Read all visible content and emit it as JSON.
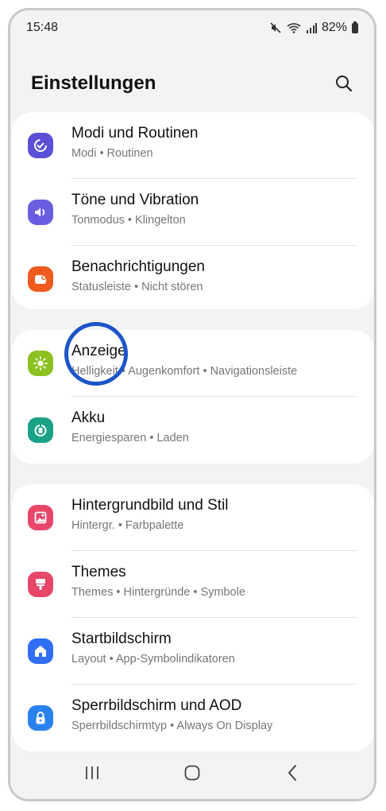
{
  "status_bar": {
    "time": "15:48",
    "battery": "82%"
  },
  "header": {
    "title": "Einstellungen"
  },
  "groups": [
    {
      "items": [
        {
          "title": "Modi und Routinen",
          "subtitle": "Modi  •  Routinen",
          "icon": "modes-icon",
          "color": "#5b4fd8"
        },
        {
          "title": "Töne und Vibration",
          "subtitle": "Tonmodus  •  Klingelton",
          "icon": "sound-icon",
          "color": "#6a5ee0"
        },
        {
          "title": "Benachrichtigungen",
          "subtitle": "Statusleiste  •  Nicht stören",
          "icon": "notification-icon",
          "color": "#ef5a1e"
        }
      ]
    },
    {
      "items": [
        {
          "title": "Anzeige",
          "subtitle": "Helligkeit  •  Augenkomfort  •  Navigationsleiste",
          "icon": "display-icon",
          "color": "#8cc11f"
        },
        {
          "title": "Akku",
          "subtitle": "Energiesparen  •  Laden",
          "icon": "battery-icon",
          "color": "#1aa286"
        }
      ]
    },
    {
      "items": [
        {
          "title": "Hintergrundbild und Stil",
          "subtitle": "Hintergr.  •  Farbpalette",
          "icon": "wallpaper-icon",
          "color": "#e8466b"
        },
        {
          "title": "Themes",
          "subtitle": "Themes  •  Hintergründe  •  Symbole",
          "icon": "themes-icon",
          "color": "#e8466b"
        },
        {
          "title": "Startbildschirm",
          "subtitle": "Layout  •  App-Symbolindikatoren",
          "icon": "home-screen-icon",
          "color": "#2f6ef5"
        },
        {
          "title": "Sperrbildschirm und AOD",
          "subtitle": "Sperrbildschirmtyp  •  Always On Display",
          "icon": "lock-screen-icon",
          "color": "#2a82f0"
        }
      ]
    }
  ]
}
